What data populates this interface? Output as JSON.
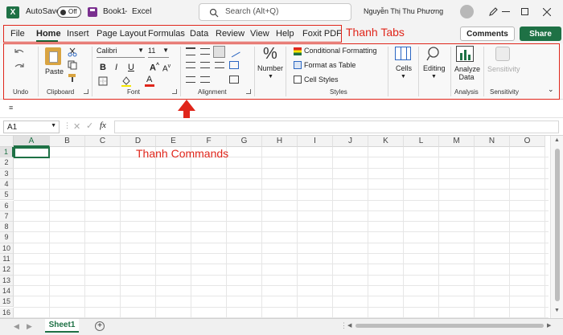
{
  "titlebar": {
    "autosave_label": "AutoSave",
    "autosave_state": "Off",
    "file_name": "Book1",
    "separator": "-",
    "app_name": "Excel",
    "search_placeholder": "Search (Alt+Q)",
    "user_name": "Nguyễn Thị Thu Phương"
  },
  "tabs": [
    "File",
    "Home",
    "Insert",
    "Page Layout",
    "Formulas",
    "Data",
    "Review",
    "View",
    "Help",
    "Foxit PDF"
  ],
  "active_tab": "Home",
  "header_buttons": {
    "comments": "Comments",
    "share": "Share"
  },
  "ribbon": {
    "undo_group": "Undo",
    "clipboard": {
      "paste": "Paste",
      "group": "Clipboard"
    },
    "font": {
      "name": "Calibri",
      "size": "11",
      "bold": "B",
      "italic": "I",
      "underline": "U",
      "font_color": "A",
      "group": "Font"
    },
    "alignment": {
      "group": "Alignment"
    },
    "number": {
      "label": "Number",
      "icon_text": "%"
    },
    "styles": {
      "conditional": "Conditional Formatting",
      "format_table": "Format as Table",
      "cell_styles": "Cell Styles",
      "group": "Styles"
    },
    "cells": "Cells",
    "editing": "Editing",
    "analysis": {
      "label": "Analyze Data",
      "group": "Analysis"
    },
    "sensitivity": {
      "label": "Sensitivity",
      "group": "Sensitivity"
    }
  },
  "formula_bar": {
    "name_box": "A1",
    "fx": "fx"
  },
  "columns": [
    "A",
    "B",
    "C",
    "D",
    "E",
    "F",
    "G",
    "H",
    "I",
    "J",
    "K",
    "L",
    "M",
    "N",
    "O"
  ],
  "rows": [
    "1",
    "2",
    "3",
    "4",
    "5",
    "6",
    "7",
    "8",
    "9",
    "10",
    "11",
    "12",
    "13",
    "14",
    "15",
    "16"
  ],
  "sheet_tab": "Sheet1",
  "annotations": {
    "tabs_label": "Thanh Tabs",
    "commands_label": "Thanh Commands"
  },
  "colors": {
    "excel_green": "#1e7145",
    "annotation_red": "#e0261b",
    "share_green": "#1e7145"
  }
}
